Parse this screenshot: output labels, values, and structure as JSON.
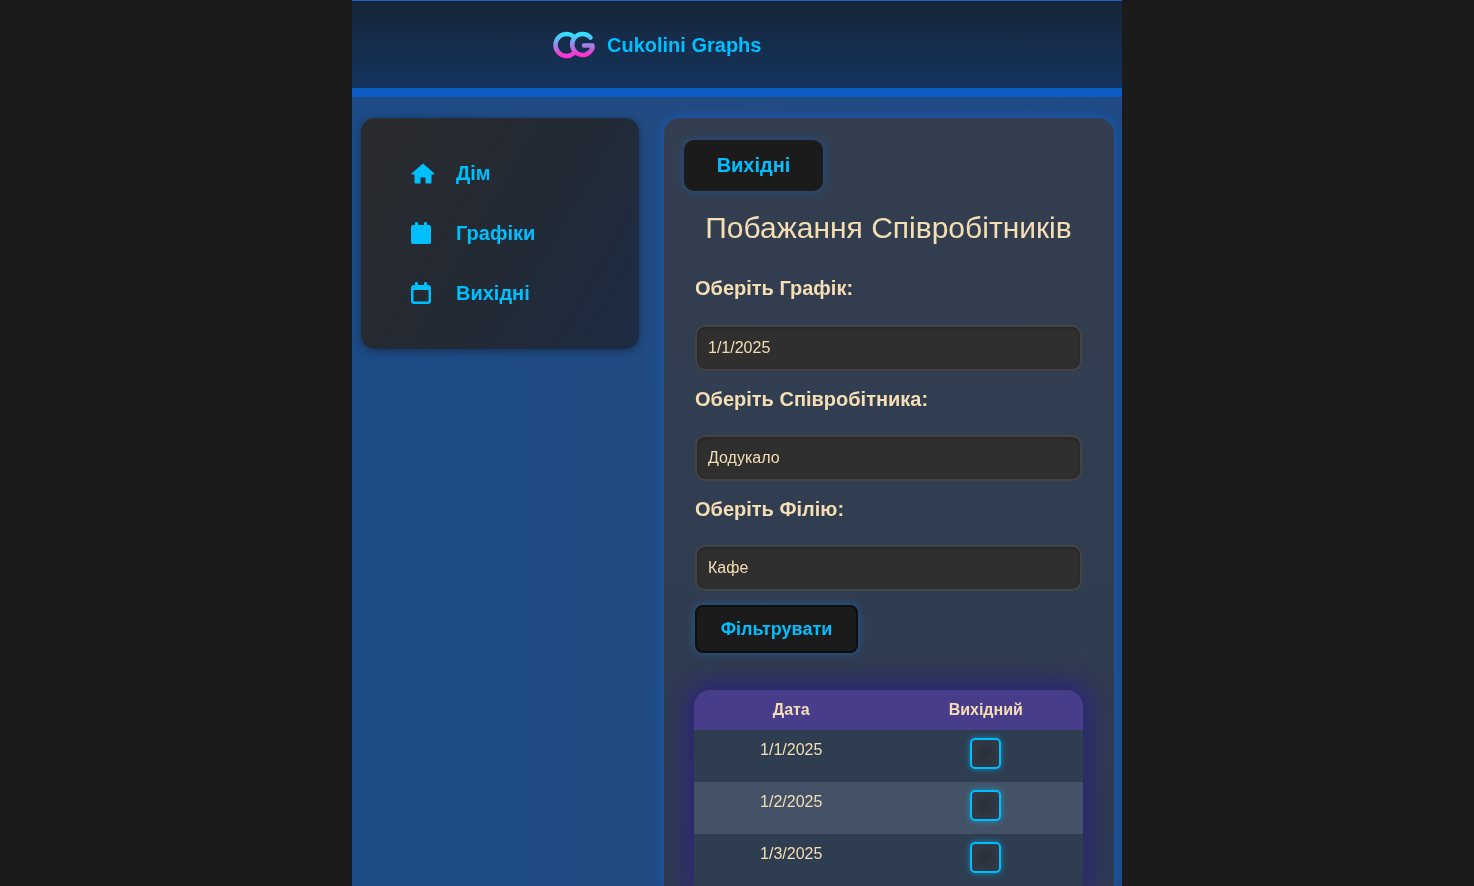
{
  "header": {
    "app_title": "Cukolini Graphs"
  },
  "sidebar": {
    "items": [
      {
        "label": "Дім"
      },
      {
        "label": "Графіки"
      },
      {
        "label": "Вихідні"
      }
    ]
  },
  "main": {
    "tab": {
      "label": "Вихідні"
    },
    "title": "Побажання Співробітників",
    "filters": [
      {
        "label": "Оберіть Графік:",
        "value": "1/1/2025"
      },
      {
        "label": "Оберіть Співробітника:",
        "value": "Додукало"
      },
      {
        "label": "Оберіть Філію:",
        "value": "Кафе"
      }
    ],
    "filter_button": "Фільтрувати",
    "table": {
      "columns": [
        "Дата",
        "Вихідний"
      ],
      "rows": [
        {
          "date": "1/1/2025",
          "day_off": false
        },
        {
          "date": "1/2/2025",
          "day_off": false
        },
        {
          "date": "1/3/2025",
          "day_off": false
        }
      ]
    }
  }
}
